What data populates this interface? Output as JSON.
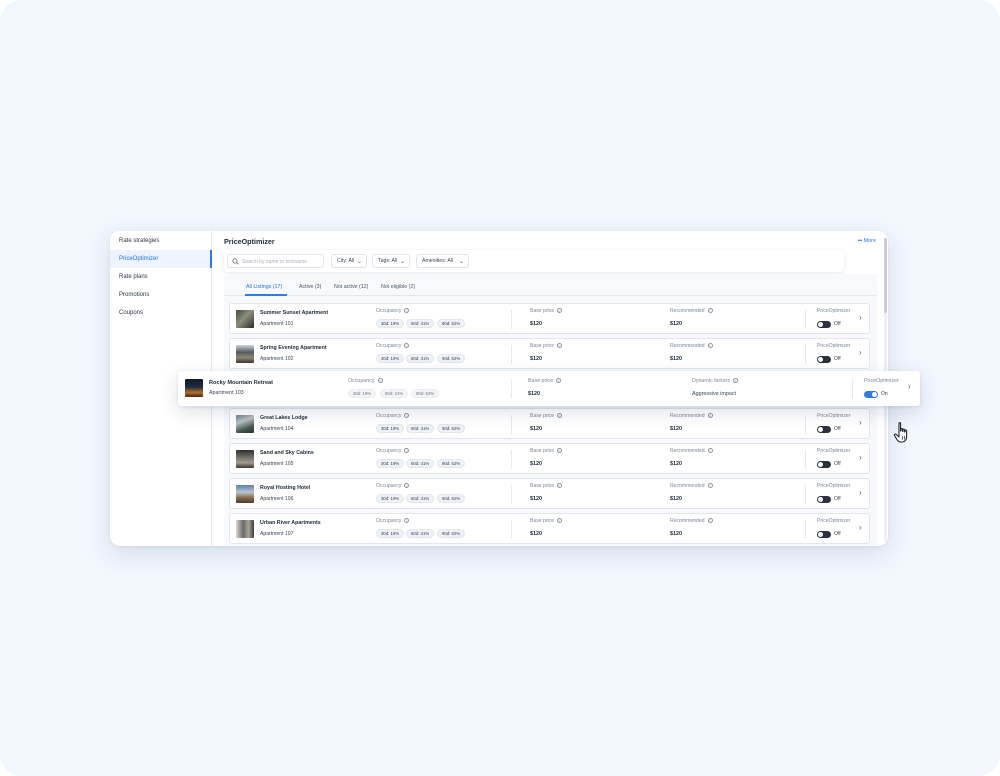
{
  "sidebar": {
    "items": [
      {
        "label": "Rate strategies"
      },
      {
        "label": "PriceOptimizer"
      },
      {
        "label": "Rate plans"
      },
      {
        "label": "Promotions"
      },
      {
        "label": "Coupons"
      }
    ]
  },
  "header": {
    "title": "PriceOptimizer",
    "more_label": "More"
  },
  "filters": {
    "search_placeholder": "Search by name or nickname",
    "city": "City: All",
    "tags": "Tags: All",
    "amenities": "Amenities: All"
  },
  "tabs": [
    {
      "label": "All Listings (17)"
    },
    {
      "label": "Active (3)"
    },
    {
      "label": "Not active (12)"
    },
    {
      "label": "Not eligible (2)"
    }
  ],
  "columns": {
    "occupancy": "Occupancy",
    "base_price": "Base price",
    "recommended": "Recommended",
    "dynamic_factors": "Dynamic factors",
    "priceoptimizer": "PriceOptimizer"
  },
  "listings": [
    {
      "name": "Summer Sunset Apartment",
      "unit": "Apartment 101",
      "occ30": "30d: 19%",
      "occ60": "60d: 41%",
      "occ90": "90d: 62%",
      "base_price": "$120",
      "recommended": "$120",
      "toggle_state": "Off"
    },
    {
      "name": "Spring Evening Apartment",
      "unit": "Apartment 102",
      "occ30": "30d: 19%",
      "occ60": "60d: 41%",
      "occ90": "90d: 62%",
      "base_price": "$120",
      "recommended": "$120",
      "toggle_state": "Off"
    },
    {
      "name": "Great Lakes Lodge",
      "unit": "Apartment 104",
      "occ30": "30d: 19%",
      "occ60": "60d: 41%",
      "occ90": "90d: 62%",
      "base_price": "$120",
      "recommended": "$120",
      "toggle_state": "Off"
    },
    {
      "name": "Sand and Sky Cabins",
      "unit": "Apartment 105",
      "occ30": "30d: 19%",
      "occ60": "60d: 41%",
      "occ90": "90d: 62%",
      "base_price": "$120",
      "recommended": "$120",
      "toggle_state": "Off"
    },
    {
      "name": "Royal Hosting Hotel",
      "unit": "Apartment 106",
      "occ30": "30d: 19%",
      "occ60": "60d: 41%",
      "occ90": "90d: 62%",
      "base_price": "$120",
      "recommended": "$120",
      "toggle_state": "Off"
    },
    {
      "name": "Urban River Apartments",
      "unit": "Apartment 107",
      "occ30": "30d: 19%",
      "occ60": "60d: 41%",
      "occ90": "90d: 62%",
      "base_price": "$120",
      "recommended": "$120",
      "toggle_state": "Off"
    }
  ],
  "highlighted_listing": {
    "name": "Rocky Mountain Retreat",
    "unit": "Apartment 103",
    "occ30": "30d: 19%",
    "occ60": "60d: 41%",
    "occ90": "90d: 62%",
    "base_price": "$120",
    "dynamic_factors": "Aggressive impact",
    "toggle_state": "On"
  },
  "icons": {
    "search": "search-icon",
    "more": "more-dots-icon",
    "info": "info-icon",
    "chevron_down": "chevron-down-icon",
    "chevron_right": "chevron-right-icon",
    "cursor": "hand-pointer-cursor-icon"
  },
  "colors": {
    "accent": "#2e7be6",
    "background": "#f2f6fd",
    "toggle_off": "#2b3140"
  }
}
